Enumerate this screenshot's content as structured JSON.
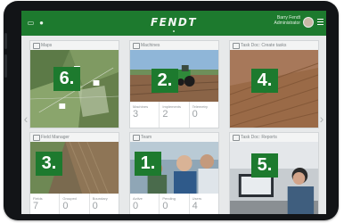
{
  "header": {
    "brand": "FENDT",
    "user_name": "Barry Fendt",
    "user_role": "Administrator"
  },
  "tiles": {
    "maps": {
      "title": "Maps",
      "number": "6."
    },
    "machines": {
      "title": "Machines",
      "number": "2.",
      "stats": [
        {
          "label": "Machines",
          "value": "3"
        },
        {
          "label": "Implements",
          "value": "2"
        },
        {
          "label": "Telemetry",
          "value": "0"
        }
      ]
    },
    "taskdoc_create": {
      "title": "Task Doc: Create tasks",
      "number": "4."
    },
    "field_manager": {
      "title": "Field Manager",
      "number": "3.",
      "stats": [
        {
          "label": "Fields",
          "value": "7"
        },
        {
          "label": "Grouped",
          "value": "0"
        },
        {
          "label": "Boundary",
          "value": "0"
        }
      ]
    },
    "team": {
      "title": "Team",
      "number": "1.",
      "stats": [
        {
          "label": "Active",
          "value": "0"
        },
        {
          "label": "Pending",
          "value": "0"
        },
        {
          "label": "Users",
          "value": "4"
        }
      ]
    },
    "taskdoc_reports": {
      "title": "Task Doc: Reports",
      "number": "5."
    }
  },
  "colors": {
    "brand_green": "#1d7a2e"
  }
}
